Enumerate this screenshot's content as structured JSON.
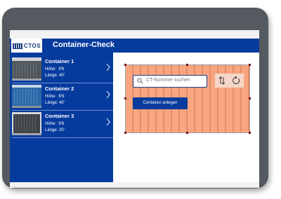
{
  "header": {
    "logo_text": "CTOS",
    "title": "Container-Check"
  },
  "sidebar": {
    "items": [
      {
        "name": "Container 1",
        "height_label": "Höhe:",
        "height_value": "9'6",
        "length_label": "Länge:",
        "length_value": "40'"
      },
      {
        "name": "Container 2",
        "height_label": "Höhe:",
        "height_value": "8'6",
        "length_label": "Länge:",
        "length_value": "40'"
      },
      {
        "name": "Container 3",
        "height_label": "Höhe:",
        "height_value": "8'6",
        "length_label": "Länge:",
        "length_value": "20'"
      }
    ]
  },
  "main": {
    "search": {
      "placeholder": "CT-Nummer suchen"
    },
    "tools": {
      "sort_icon": "sort-arrows-icon",
      "refresh_icon": "refresh-icon"
    },
    "add_button_label": "Container anlegen"
  },
  "colors": {
    "brand_blue": "#063b9e",
    "container_orange": "#f7a680",
    "tablet_frame": "#555a60"
  }
}
